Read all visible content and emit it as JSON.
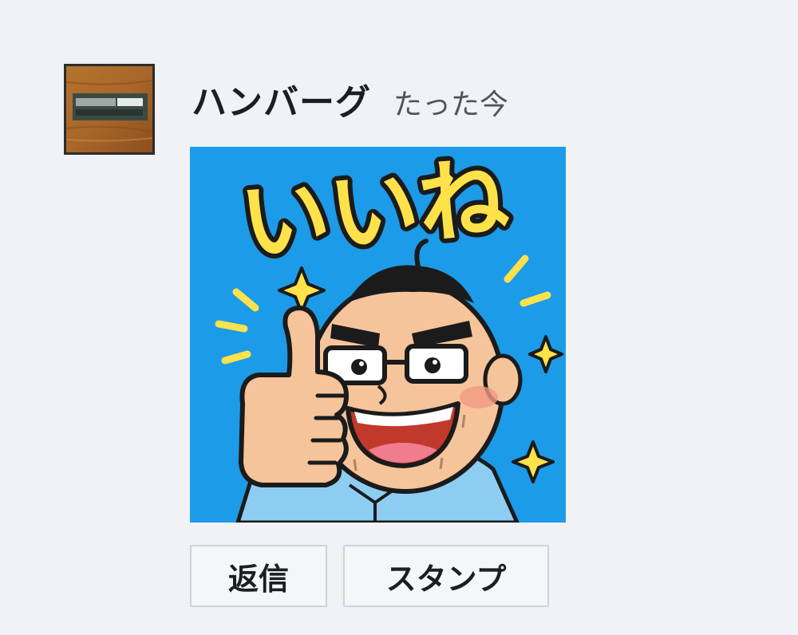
{
  "post": {
    "author": "ハンバーグ",
    "time": "たった今",
    "sticker": {
      "text": "いいね",
      "icon": "thumbs-up-sticker",
      "colors": {
        "background": "#1c9be8",
        "text_fill": "#ffe24a",
        "text_outline": "#1b1b1b",
        "skin": "#f6c49a",
        "shirt": "#8ecdf2"
      }
    },
    "actions": {
      "reply_label": "返信",
      "stamp_label": "スタンプ"
    }
  }
}
